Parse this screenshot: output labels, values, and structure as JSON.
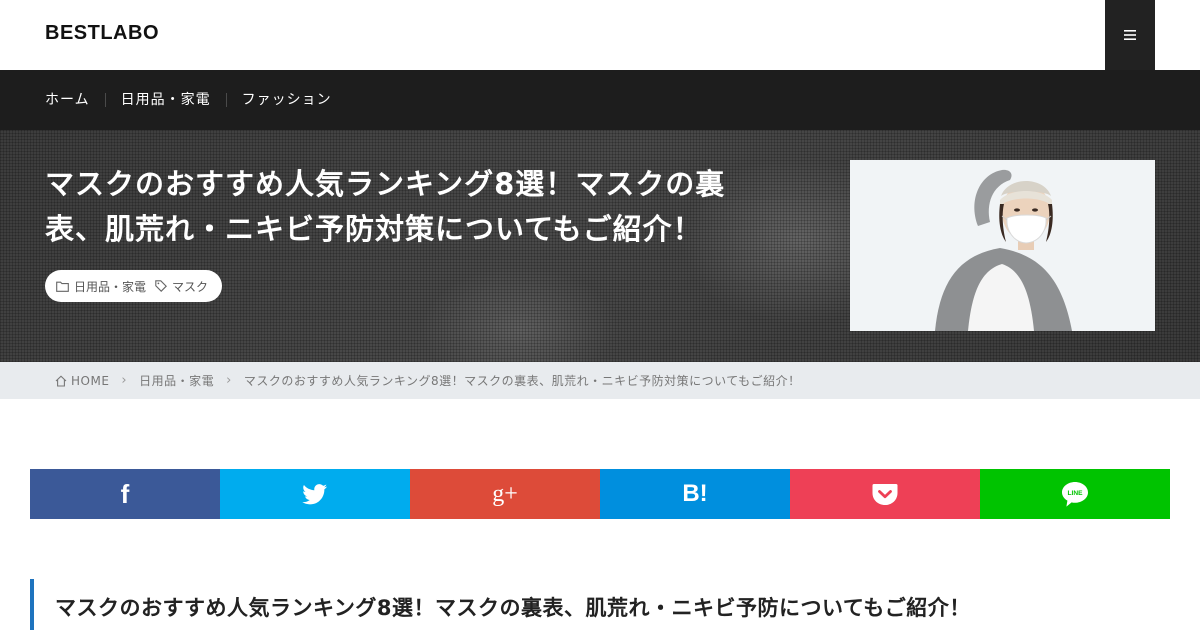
{
  "header": {
    "logo": "BESTLABO",
    "menu_icon": "hamburger-icon"
  },
  "nav": {
    "items": [
      {
        "label": "ホーム"
      },
      {
        "label": "日用品・家電"
      },
      {
        "label": "ファッション"
      }
    ]
  },
  "hero": {
    "title_line1": "マスクのおすすめ人気ランキング8選！マスクの裏",
    "title_line2": "表、肌荒れ・ニキビ予防対策についてもご紹介！",
    "category": "日用品・家電",
    "tag": "マスク",
    "category_icon": "folder-icon",
    "tag_icon": "tag-icon",
    "thumbnail": "woman-wearing-mask-photo"
  },
  "breadcrumb": {
    "home": "HOME",
    "category": "日用品・家電",
    "current": "マスクのおすすめ人気ランキング8選！マスクの裏表、肌荒れ・ニキビ予防対策についてもご紹介！",
    "home_icon": "home-icon",
    "separator_icon": "chevron-right-icon"
  },
  "share": {
    "facebook": {
      "glyph": "f",
      "color": "#3b5998"
    },
    "twitter": {
      "color": "#00acee"
    },
    "googleplus": {
      "glyph": "g+",
      "color": "#dd4b39"
    },
    "hatena": {
      "glyph": "B!",
      "color": "#008fde"
    },
    "pocket": {
      "color": "#ee4056"
    },
    "line": {
      "glyph": "LINE",
      "color": "#00c300"
    }
  },
  "content": {
    "headline": "マスクのおすすめ人気ランキング8選！マスクの裏表、肌荒れ・ニキビ予防についてもご紹介！",
    "accent_color": "#1e73be"
  }
}
